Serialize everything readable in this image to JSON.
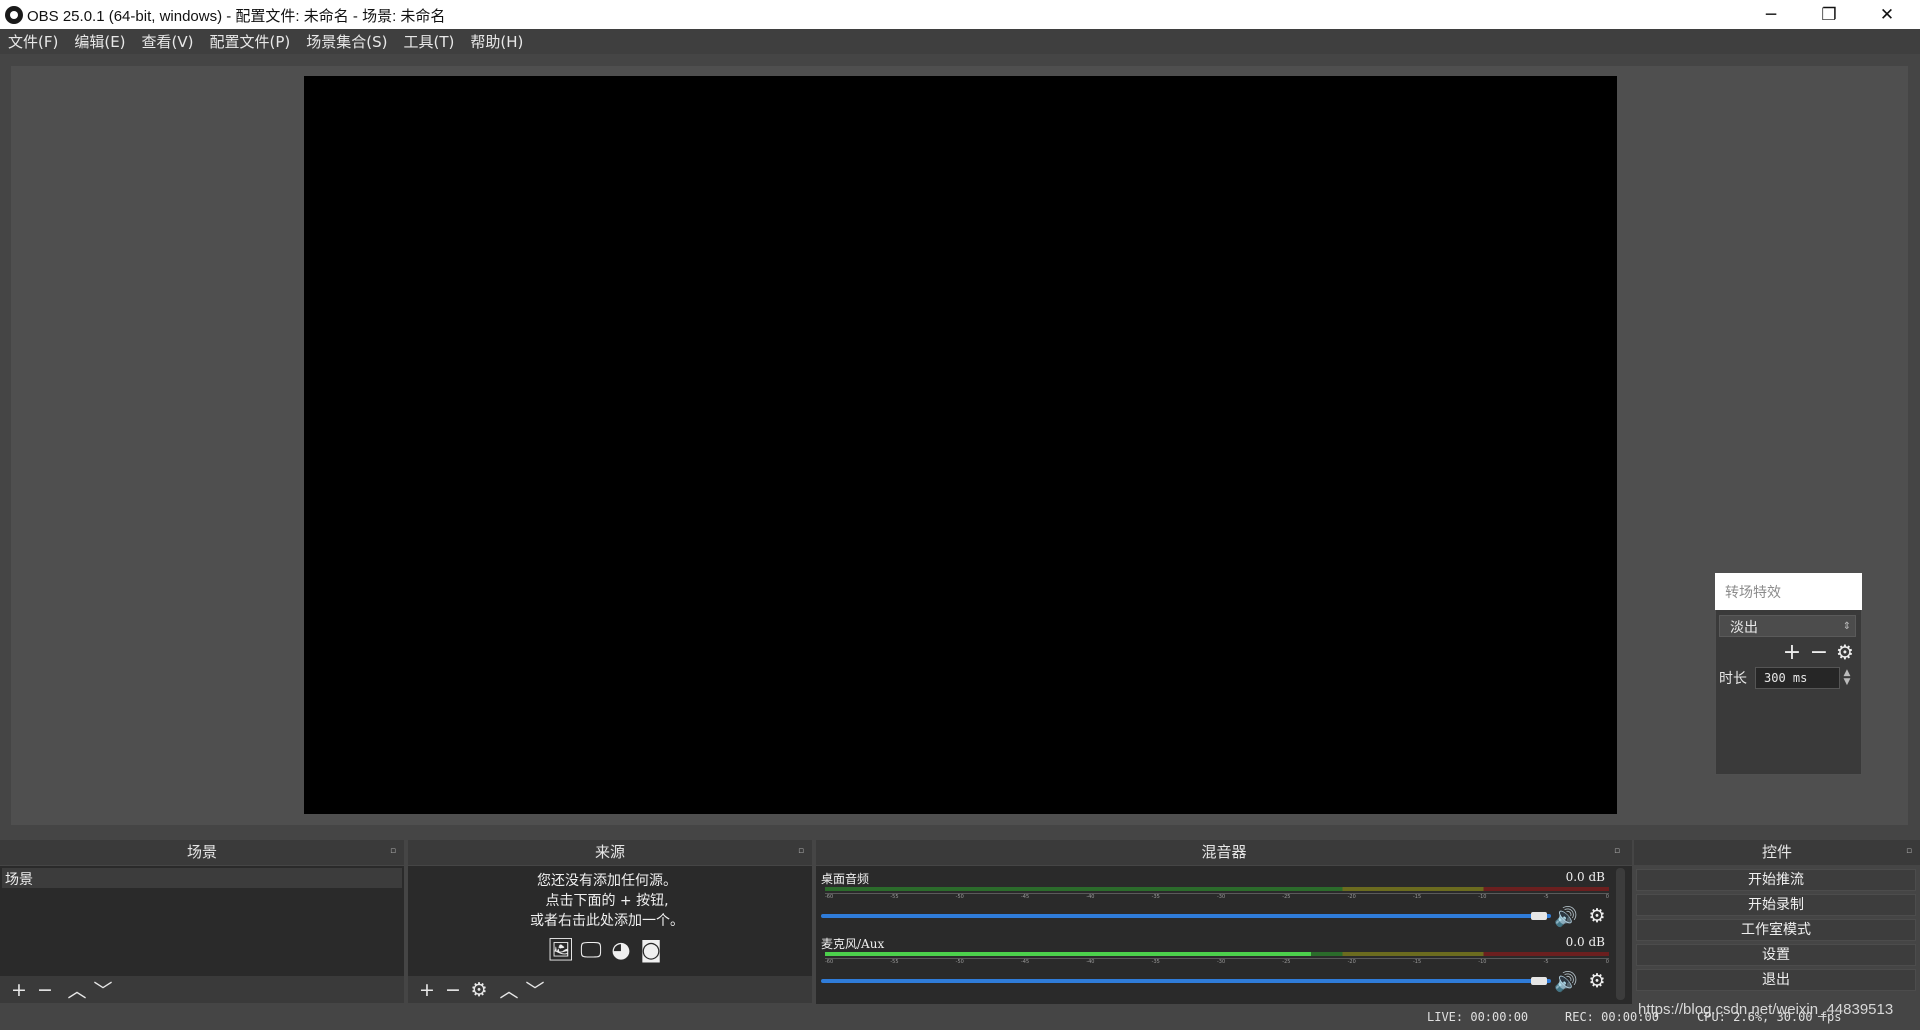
{
  "window": {
    "title": "OBS 25.0.1 (64-bit, windows) - 配置文件: 未命名 - 场景: 未命名",
    "minimize_glyph": "─",
    "restore_glyph": "❐",
    "close_glyph": "✕"
  },
  "menu": [
    "文件(F)",
    "编辑(E)",
    "查看(V)",
    "配置文件(P)",
    "场景集合(S)",
    "工具(T)",
    "帮助(H)"
  ],
  "transition": {
    "header": "转场特效",
    "selected": "淡出",
    "duration_label": "时长",
    "duration_value": "300 ms"
  },
  "docks": {
    "scenes": {
      "title": "场景",
      "items": [
        "场景"
      ]
    },
    "sources": {
      "title": "来源",
      "hint_lines": [
        "您还没有添加任何源。",
        "点击下面的 + 按钮,",
        "或者右击此处添加一个。"
      ]
    },
    "mixer": {
      "title": "混音器",
      "channels": [
        {
          "name": "桌面音频",
          "db": "0.0 dB",
          "level": 0.0,
          "volume": 1.0
        },
        {
          "name": "麦克风/Aux",
          "db": "0.0 dB",
          "level": 0.62,
          "volume": 1.0
        }
      ],
      "ticks": [
        "-60",
        "-55",
        "-50",
        "-45",
        "-40",
        "-35",
        "-30",
        "-25",
        "-20",
        "-15",
        "-10",
        "-5",
        "0"
      ]
    },
    "controls": {
      "title": "控件",
      "buttons": [
        "开始推流",
        "开始录制",
        "工作室模式",
        "设置",
        "退出"
      ]
    }
  },
  "status": {
    "live": "LIVE: 00:00:00",
    "rec": "REC: 00:00:00",
    "cpu": "CPU: 2.6%, 30.00 fps"
  },
  "watermark": "https://blog.csdn.net/weixin_44839513",
  "colors": {
    "accent": "#2f7cd9",
    "canvas": "#000000",
    "background": "#454545"
  }
}
